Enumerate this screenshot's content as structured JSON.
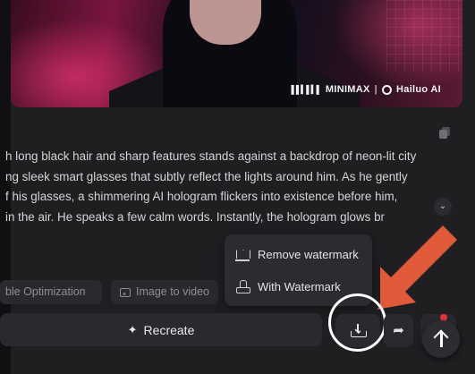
{
  "thumbnail": {
    "brand_minimax": "MINIMAX",
    "brand_hailuo": "Hailuo AI"
  },
  "prompt": {
    "lines": [
      "h long black hair and sharp features stands against a backdrop of neon-lit city",
      "ng sleek smart glasses that subtly reflect the lights around him. As he gently",
      "f his glasses, a shimmering AI hologram flickers into existence before him,",
      "in the air. He speaks a few calm words. Instantly, the hologram glows br"
    ]
  },
  "chips": {
    "optimization": "ble Optimization",
    "image_to_video": "Image to video"
  },
  "download_menu": {
    "remove_watermark": "Remove watermark",
    "with_watermark": "With Watermark"
  },
  "actions": {
    "recreate": "Recreate"
  },
  "colors": {
    "annotation_arrow": "#e05a3a",
    "annotation_circle": "#ffffff",
    "notification_dot": "#e5363c"
  },
  "icons": {
    "download": "download-icon",
    "share": "share-icon",
    "scroll_top": "arrow-up-icon",
    "copy": "copy-icon",
    "expand": "chevron-down-icon",
    "sparkle": "sparkle-icon",
    "crown": "crown-icon",
    "stamp": "stamp-icon",
    "image": "image-icon"
  }
}
